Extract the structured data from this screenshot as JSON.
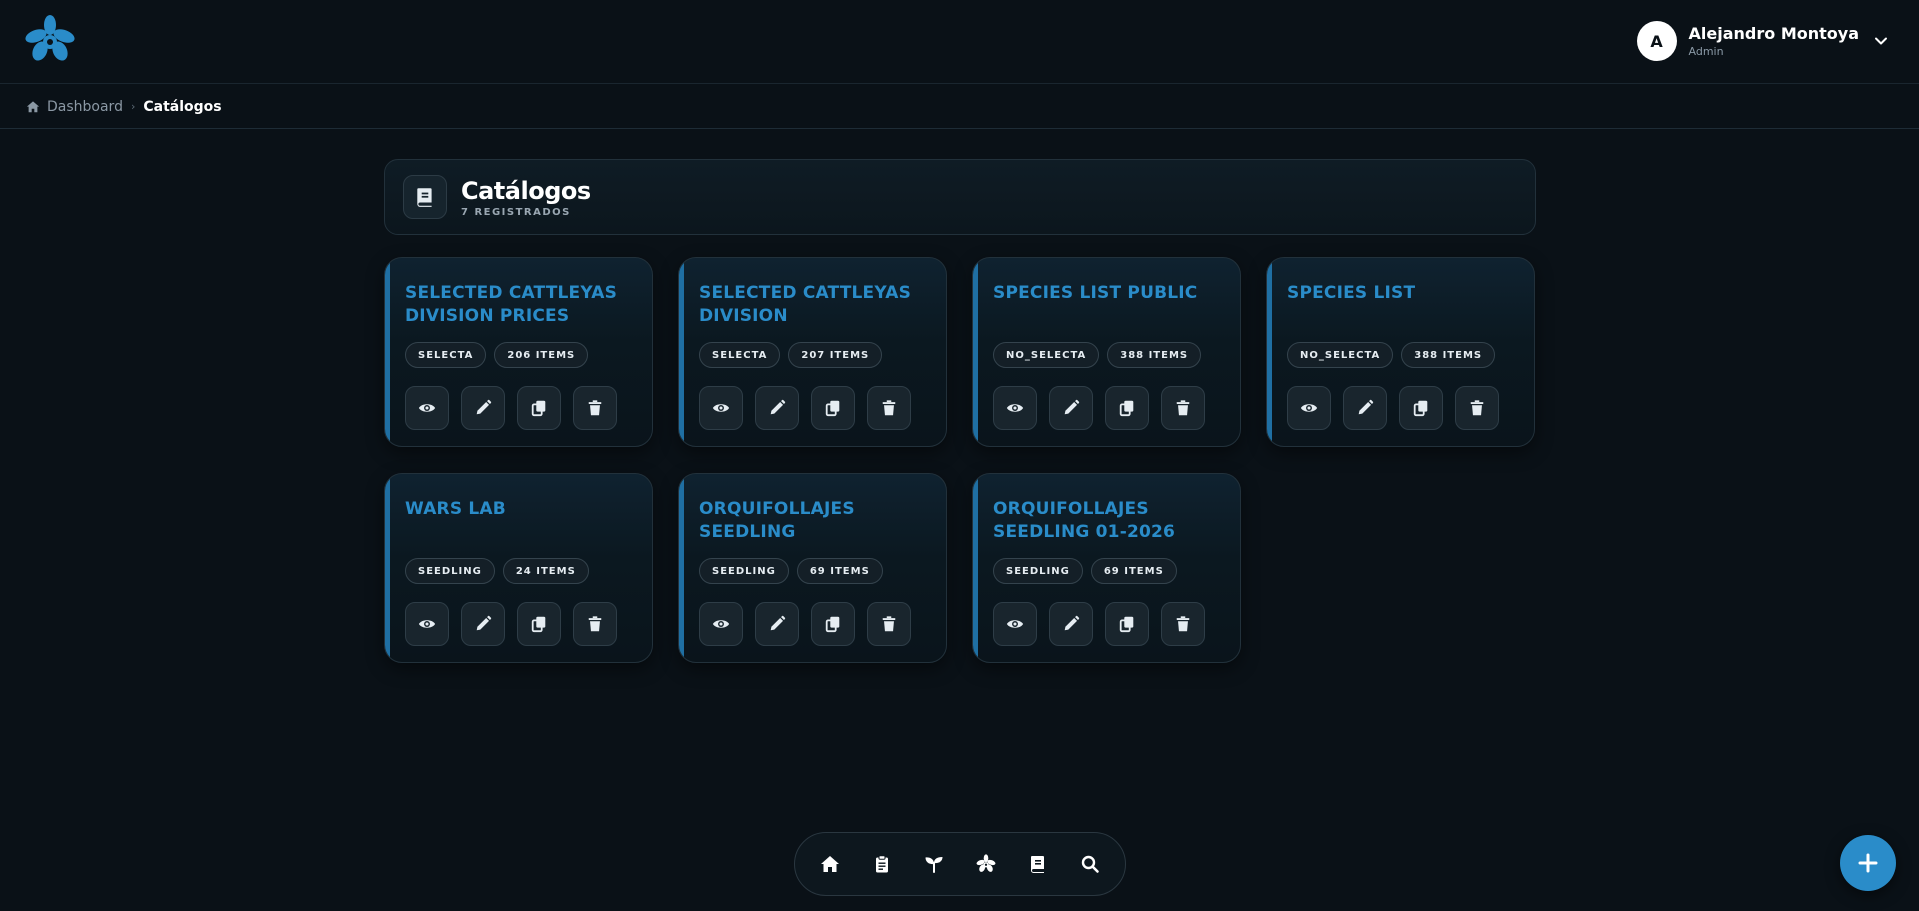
{
  "user": {
    "initial": "A",
    "name": "Alejandro Montoya",
    "role": "Admin"
  },
  "breadcrumb": {
    "home": "Dashboard",
    "current": "Catálogos"
  },
  "header": {
    "title": "Catálogos",
    "subtitle": "7 REGISTRADOS"
  },
  "catalogs": [
    {
      "title": "SELECTED CATTLEYAS DIVISION PRICES",
      "type": "SELECTA",
      "items": "206 ITEMS"
    },
    {
      "title": "SELECTED CATTLEYAS DIVISION",
      "type": "SELECTA",
      "items": "207 ITEMS"
    },
    {
      "title": "SPECIES LIST PUBLIC",
      "type": "NO_SELECTA",
      "items": "388 ITEMS"
    },
    {
      "title": "SPECIES LIST",
      "type": "NO_SELECTA",
      "items": "388 ITEMS"
    },
    {
      "title": "WARS LAB",
      "type": "SEEDLING",
      "items": "24 ITEMS"
    },
    {
      "title": "ORQUIFOLLAJES SEEDLING",
      "type": "SEEDLING",
      "items": "69 ITEMS"
    },
    {
      "title": "ORQUIFOLLAJES SEEDLING 01-2026",
      "type": "SEEDLING",
      "items": "69 ITEMS"
    }
  ],
  "card_actions": [
    "eye-icon",
    "pencil-icon",
    "copy-icon",
    "trash-icon"
  ],
  "bottom_nav": [
    "home-icon",
    "clipboard-icon",
    "sprout-icon",
    "orchid-icon",
    "book-icon",
    "search-icon"
  ],
  "colors": {
    "accent": "#2a8cc9",
    "background": "#0a1117",
    "card_stripe": "#1f6fa3"
  }
}
